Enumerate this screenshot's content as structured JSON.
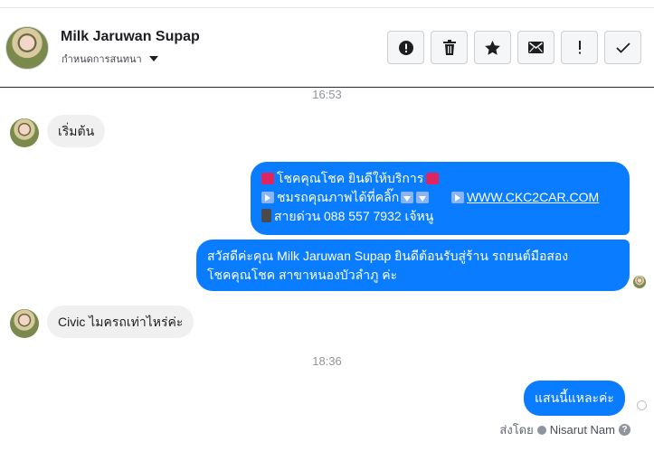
{
  "header": {
    "name": "Milk Jaruwan Supap",
    "subtitle": "กำหนดการสนทนา"
  },
  "toolbar": [
    {
      "name": "spam-button",
      "icon": "exclamation-circle-icon"
    },
    {
      "name": "delete-button",
      "icon": "trash-icon"
    },
    {
      "name": "star-button",
      "icon": "star-icon"
    },
    {
      "name": "mark-unread-button",
      "icon": "envelope-icon"
    },
    {
      "name": "mark-important-button",
      "icon": "exclamation-icon"
    },
    {
      "name": "mark-done-button",
      "icon": "check-icon"
    }
  ],
  "conversation": {
    "time_1": "16:53",
    "time_2": "18:36",
    "msg_1": "เริ่มต้น",
    "out_1": {
      "line1": "โชคคุณโชค ยินดีให้บริการ",
      "line2": "ชมรถคุณภาพได้ที่คลิ๊ก",
      "link": "WWW.CKC2CAR.COM",
      "line3": "สายด่วน 088 557 7932 เจ้หนู"
    },
    "out_2": {
      "line1": "สวัสดีค่ะคุณ Milk Jaruwan Supap ยินดีต้อนรับสู่ร้าน รถยนต์มือสอง",
      "line2": "โชคคุณโชค สาขาหนองบัวลำภู ค่ะ"
    },
    "msg_2": "Civic ไมครถเท่าไหร่ค่ะ",
    "out_3": "แสนนี้แหละค่ะ",
    "sent_by_label": "ส่งโดย",
    "sent_by_name": "Nisarut Nam"
  },
  "colors": {
    "accent": "#0a7cff",
    "incoming_bubble": "#f1f0f0"
  }
}
